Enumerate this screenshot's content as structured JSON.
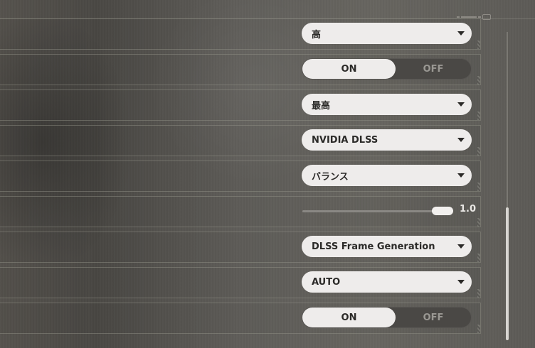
{
  "settings": {
    "rows": [
      {
        "type": "dropdown",
        "value": "高"
      },
      {
        "type": "toggle",
        "on_label": "ON",
        "off_label": "OFF",
        "selected": "ON"
      },
      {
        "type": "dropdown",
        "value": "最高"
      },
      {
        "type": "dropdown",
        "value": "NVIDIA DLSS"
      },
      {
        "type": "dropdown",
        "value": "バランス"
      },
      {
        "type": "slider",
        "value": "1.0",
        "fill_fraction": 1.0
      },
      {
        "type": "dropdown",
        "value": "DLSS Frame Generation"
      },
      {
        "type": "dropdown",
        "value": "AUTO"
      },
      {
        "type": "toggle",
        "on_label": "ON",
        "off_label": "OFF",
        "selected": "ON"
      }
    ]
  },
  "scrollbar": {
    "position_fraction": 1.0,
    "visible_fraction": 0.43
  }
}
